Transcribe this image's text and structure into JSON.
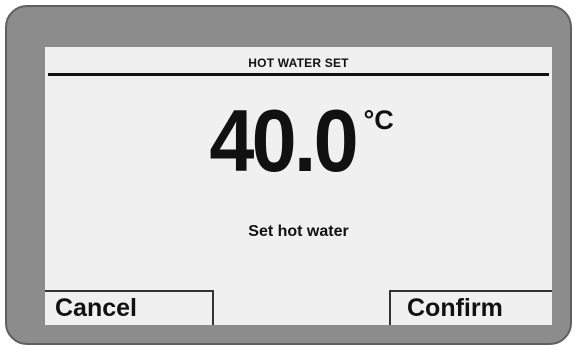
{
  "header": {
    "title": "HOT WATER SET"
  },
  "setpoint": {
    "value": "40.0",
    "unit": "°C",
    "label": "Set hot water"
  },
  "softkeys": {
    "cancel_label": "Cancel",
    "confirm_label": "Confirm"
  },
  "colors": {
    "bezel": "#8c8c8c",
    "screen": "#f0f0f0",
    "text": "#111111"
  }
}
